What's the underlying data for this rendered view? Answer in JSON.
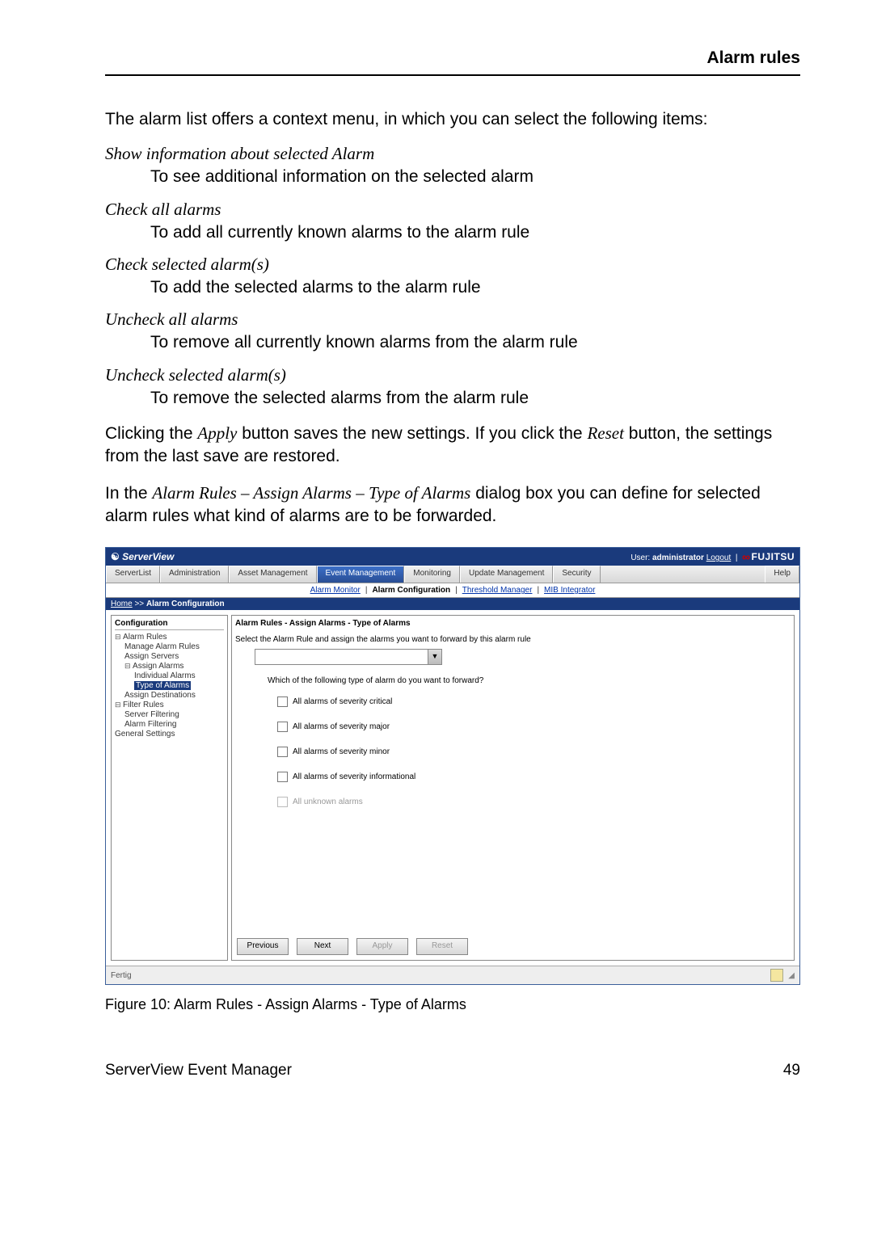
{
  "header": {
    "title": "Alarm rules"
  },
  "intro": "The alarm list offers a context menu, in which you can select the following items:",
  "defs": [
    {
      "term": "Show information about selected Alarm",
      "desc": "To see additional information on the selected alarm"
    },
    {
      "term": "Check all alarms",
      "desc": "To add all currently known alarms to the alarm rule"
    },
    {
      "term": "Check selected alarm(s)",
      "desc": "To add the selected alarms to the alarm rule"
    },
    {
      "term": "Uncheck all alarms",
      "desc": "To remove all currently known alarms from the alarm rule"
    },
    {
      "term": "Uncheck selected alarm(s)",
      "desc": "To remove the selected alarms from the alarm rule"
    }
  ],
  "para2a": "Clicking the ",
  "para2b": "Apply",
  "para2c": " button saves the new settings. If you click the ",
  "para2d": "Reset",
  "para2e": " button, the settings from the last save are restored.",
  "para3a": "In the ",
  "para3b": "Alarm Rules – Assign Alarms  – Type of Alarms",
  "para3c": " dialog box you can define for selected alarm rules what kind of alarms are to be forwarded.",
  "sv": {
    "title_left": "ServerView",
    "user_label": "User:",
    "user_name": "administrator",
    "logout": "Logout",
    "brand": "FUJITSU",
    "tabs": [
      "ServerList",
      "Administration",
      "Asset Management",
      "Event Management",
      "Monitoring",
      "Update Management",
      "Security"
    ],
    "help": "Help",
    "subtabs": [
      "Alarm Monitor",
      "Alarm Configuration",
      "Threshold Manager",
      "MIB Integrator"
    ],
    "bc_home": "Home",
    "bc_sep": " >> ",
    "bc_current": "Alarm Configuration",
    "side_title": "Configuration",
    "tree": {
      "n1": "Alarm Rules",
      "n1a": "Manage Alarm Rules",
      "n1b": "Assign Servers",
      "n1c": "Assign Alarms",
      "n1c1": "Individual Alarms",
      "n1c2": "Type of Alarms",
      "n1d": "Assign Destinations",
      "n2": "Filter Rules",
      "n2a": "Server Filtering",
      "n2b": "Alarm Filtering",
      "n3": "General Settings"
    },
    "content_title": "Alarm Rules - Assign Alarms - Type of Alarms",
    "content_desc": "Select the Alarm Rule and assign the alarms you want to forward by this alarm rule",
    "question": "Which of the following type of alarm do you want to forward?",
    "checks": [
      {
        "label": "All alarms of severity critical",
        "disabled": false
      },
      {
        "label": "All alarms of severity major",
        "disabled": false
      },
      {
        "label": "All alarms of severity minor",
        "disabled": false
      },
      {
        "label": "All alarms of severity informational",
        "disabled": false
      },
      {
        "label": "All unknown alarms",
        "disabled": true
      }
    ],
    "buttons": {
      "prev": "Previous",
      "next": "Next",
      "apply": "Apply",
      "reset": "Reset"
    },
    "status": "Fertig"
  },
  "caption": "Figure 10: Alarm Rules - Assign Alarms - Type of Alarms",
  "footer": {
    "left": "ServerView Event Manager",
    "right": "49"
  }
}
